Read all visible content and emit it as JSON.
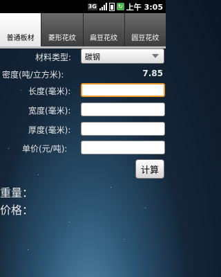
{
  "status_bar": {
    "network": "3G",
    "time": "上午 3:05"
  },
  "tabs": [
    {
      "label": "普通板材",
      "active": true
    },
    {
      "label": "菱形花纹",
      "active": false
    },
    {
      "label": "扁豆花纹",
      "active": false
    },
    {
      "label": "圆豆花纹",
      "active": false
    }
  ],
  "form": {
    "material_type_label": "材料类型:",
    "material_type_value": "碳钢",
    "density_label": "密度(吨/立方米):",
    "density_value": "7.85",
    "length_label": "长度(毫米):",
    "length_value": "",
    "width_label": "宽度(毫米):",
    "width_value": "",
    "thickness_label": "厚度(毫米):",
    "thickness_value": "",
    "price_label": "单价(元/吨):",
    "price_value": "",
    "calculate_label": "计算"
  },
  "results": {
    "weight_label": "重量：",
    "price_label": "价格："
  }
}
